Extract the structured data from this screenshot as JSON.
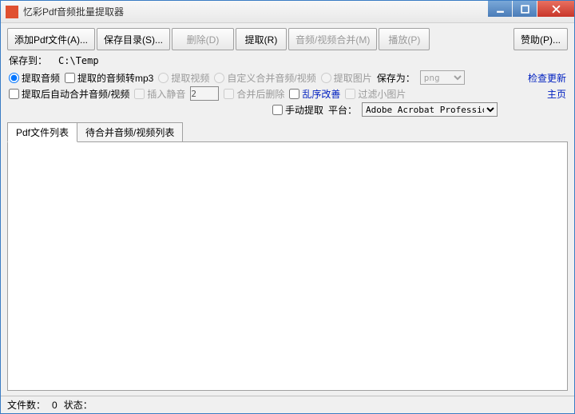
{
  "window": {
    "title": "忆彩Pdf音频批量提取器"
  },
  "toolbar": {
    "add": "添加Pdf文件(A)...",
    "savedir": "保存目录(S)...",
    "delete": "删除(D)",
    "extract": "提取(R)",
    "avmerge": "音频/视频合并(M)",
    "play": "播放(P)",
    "sponsor": "赞助(P)..."
  },
  "saveto": {
    "label": "保存到：",
    "path": "C:\\Temp"
  },
  "opts": {
    "extract_audio": "提取音频",
    "audio_to_mp3": "提取的音频转mp3",
    "extract_video": "提取视频",
    "custom_merge_av": "自定义合并音频/视频",
    "extract_image": "提取图片",
    "save_as": "保存为：",
    "auto_merge_av": "提取后自动合并音频/视频",
    "insert_silence": "插入静音",
    "merge_then_delete": "合并后删除",
    "random_improve": "乱序改善",
    "filter_small_img": "过滤小图片",
    "manual_extract": "手动提取",
    "platform_label": "平台：",
    "spin_value": "2"
  },
  "selects": {
    "imgfmt": "png",
    "platform": "Adobe Acrobat Profession"
  },
  "links": {
    "check_update": "检查更新",
    "home": "主页"
  },
  "tabs": {
    "pdflist": "Pdf文件列表",
    "mergelist": "待合并音频/视频列表"
  },
  "status": {
    "filecount_label": "文件数：",
    "filecount": "0",
    "state_label": "状态："
  }
}
